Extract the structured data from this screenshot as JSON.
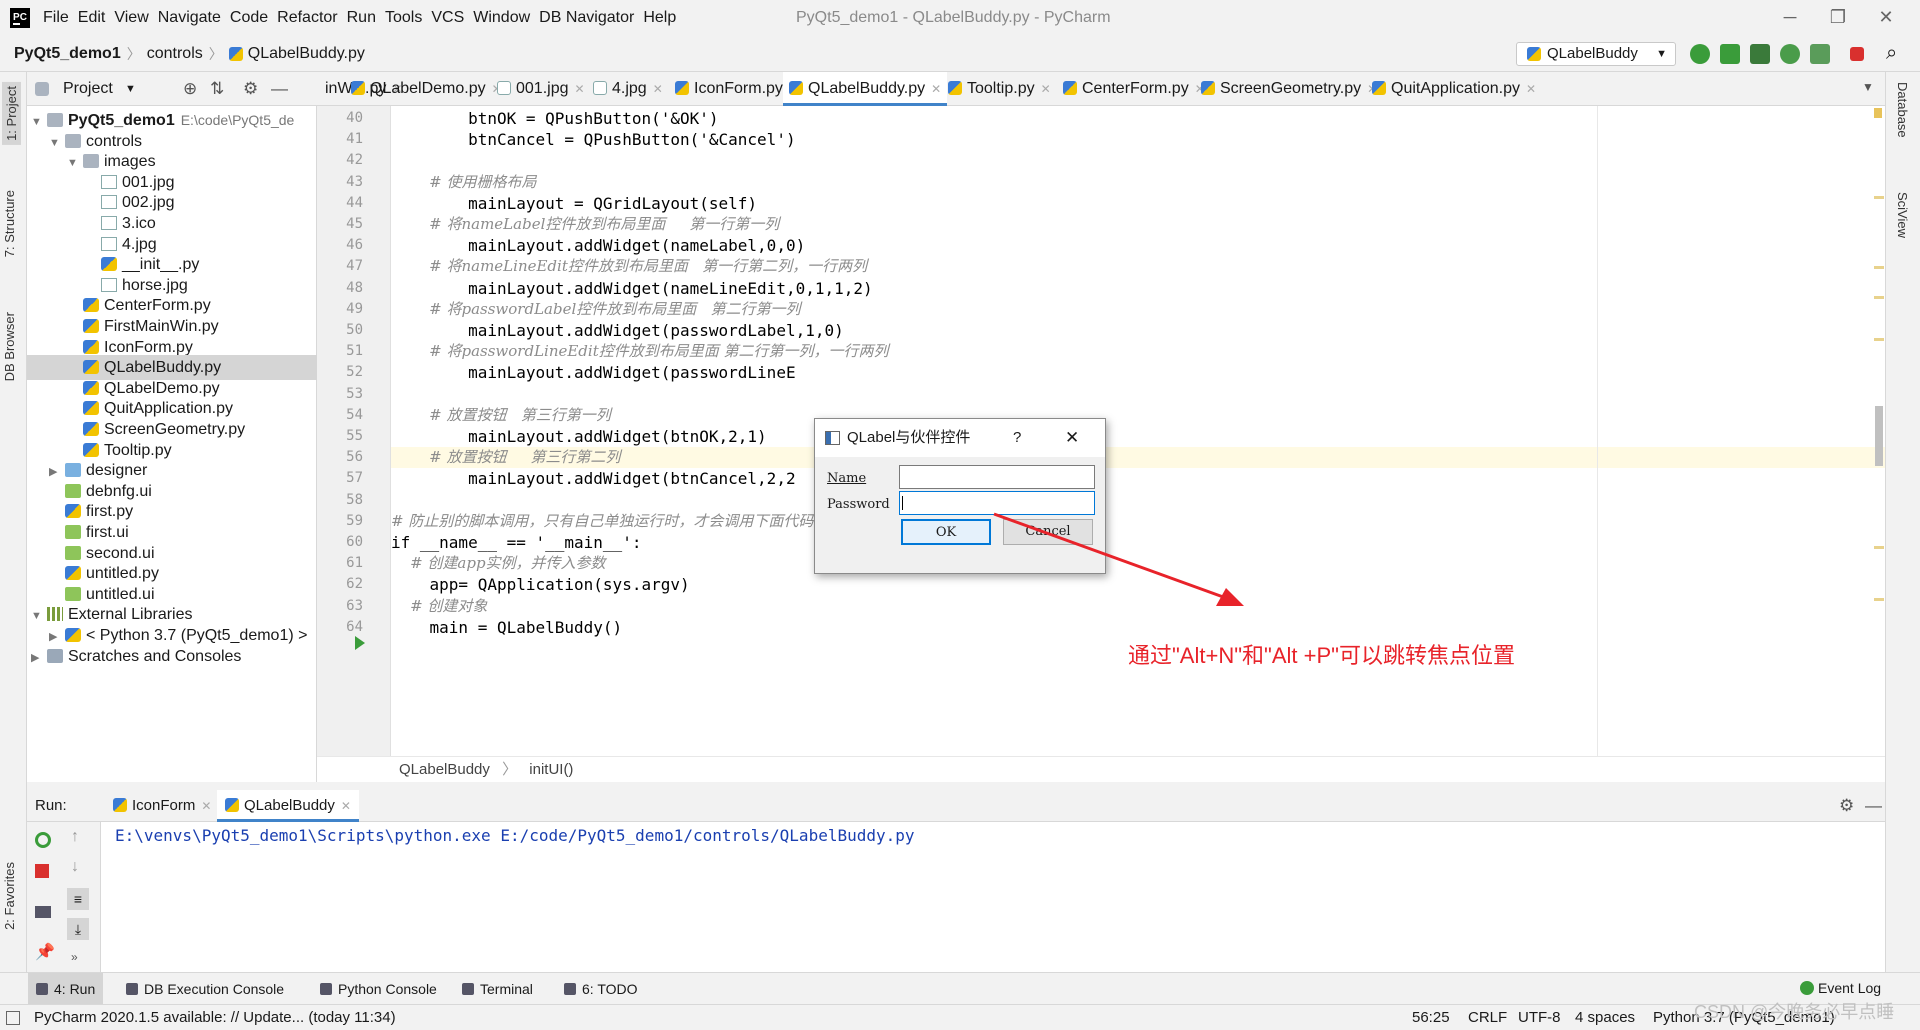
{
  "menu": {
    "items": [
      "File",
      "Edit",
      "View",
      "Navigate",
      "Code",
      "Refactor",
      "Run",
      "Tools",
      "VCS",
      "Window",
      "DB Navigator",
      "Help"
    ],
    "window_title": "PyQt5_demo1 - QLabelBuddy.py - PyCharm"
  },
  "nav": {
    "crumbs": [
      "PyQt5_demo1",
      "controls",
      "QLabelBuddy.py"
    ],
    "run_config": "QLabelBuddy"
  },
  "left_strip": {
    "project": "1: Project",
    "structure": "7: Structure",
    "db_browser": "DB Browser",
    "favorites": "2: Favorites"
  },
  "right_strip": {
    "database": "Database",
    "sciview": "SciView"
  },
  "project_panel": {
    "title": "Project",
    "tree": [
      {
        "label": "PyQt5_demo1",
        "extra": "E:\\code\\PyQt5_de",
        "depth": 0,
        "icon": "folder",
        "arrow": "▼",
        "bold": true
      },
      {
        "label": "controls",
        "depth": 1,
        "icon": "folder",
        "arrow": "▼"
      },
      {
        "label": "images",
        "depth": 2,
        "icon": "folder",
        "arrow": "▼"
      },
      {
        "label": "001.jpg",
        "depth": 3,
        "icon": "img"
      },
      {
        "label": "002.jpg",
        "depth": 3,
        "icon": "img"
      },
      {
        "label": "3.ico",
        "depth": 3,
        "icon": "img"
      },
      {
        "label": "4.jpg",
        "depth": 3,
        "icon": "img"
      },
      {
        "label": "__init__.py",
        "depth": 3,
        "icon": "py"
      },
      {
        "label": "horse.jpg",
        "depth": 3,
        "icon": "img"
      },
      {
        "label": "CenterForm.py",
        "depth": 2,
        "icon": "py"
      },
      {
        "label": "FirstMainWin.py",
        "depth": 2,
        "icon": "py"
      },
      {
        "label": "IconForm.py",
        "depth": 2,
        "icon": "py"
      },
      {
        "label": "QLabelBuddy.py",
        "depth": 2,
        "icon": "py",
        "selected": true
      },
      {
        "label": "QLabelDemo.py",
        "depth": 2,
        "icon": "py"
      },
      {
        "label": "QuitApplication.py",
        "depth": 2,
        "icon": "py"
      },
      {
        "label": "ScreenGeometry.py",
        "depth": 2,
        "icon": "py"
      },
      {
        "label": "Tooltip.py",
        "depth": 2,
        "icon": "py"
      },
      {
        "label": "designer",
        "depth": 1,
        "icon": "folder-blue",
        "arrow": "▶"
      },
      {
        "label": "debnfg.ui",
        "depth": 1,
        "icon": "ui"
      },
      {
        "label": "first.py",
        "depth": 1,
        "icon": "py"
      },
      {
        "label": "first.ui",
        "depth": 1,
        "icon": "ui"
      },
      {
        "label": "second.ui",
        "depth": 1,
        "icon": "ui"
      },
      {
        "label": "untitled.py",
        "depth": 1,
        "icon": "py"
      },
      {
        "label": "untitled.ui",
        "depth": 1,
        "icon": "ui"
      },
      {
        "label": "External Libraries",
        "depth": 0,
        "icon": "lib",
        "arrow": "▼"
      },
      {
        "label": "< Python 3.7 (PyQt5_demo1) >",
        "depth": 1,
        "icon": "py",
        "arrow": "▶"
      },
      {
        "label": "Scratches and Consoles",
        "depth": 0,
        "icon": "scratch",
        "arrow": "▶"
      }
    ]
  },
  "editor_tabs": [
    {
      "label": "inWin.py",
      "icon": "none"
    },
    {
      "label": "QLabelDemo.py",
      "icon": "py"
    },
    {
      "label": "001.jpg",
      "icon": "img"
    },
    {
      "label": "4.jpg",
      "icon": "img"
    },
    {
      "label": "IconForm.py",
      "icon": "py"
    },
    {
      "label": "QLabelBuddy.py",
      "icon": "py",
      "active": true
    },
    {
      "label": "Tooltip.py",
      "icon": "py"
    },
    {
      "label": "CenterForm.py",
      "icon": "py"
    },
    {
      "label": "ScreenGeometry.py",
      "icon": "py"
    },
    {
      "label": "QuitApplication.py",
      "icon": "py"
    }
  ],
  "code": {
    "lines": [
      {
        "n": "40",
        "text": "        btnOK = QPushButton('&OK')"
      },
      {
        "n": "41",
        "text": "        btnCancel = QPushButton('&Cancel')"
      },
      {
        "n": "42",
        "text": ""
      },
      {
        "n": "43",
        "text": "        # 使用栅格布局",
        "comment": true
      },
      {
        "n": "44",
        "text": "        mainLayout = QGridLayout(self)"
      },
      {
        "n": "45",
        "text": "        # 将nameLabel控件放到布局里面     第一行第一列",
        "comment": true
      },
      {
        "n": "46",
        "text": "        mainLayout.addWidget(nameLabel,0,0)"
      },
      {
        "n": "47",
        "text": "        # 将nameLineEdit控件放到布局里面   第一行第二列，一行两列",
        "comment": true
      },
      {
        "n": "48",
        "text": "        mainLayout.addWidget(nameLineEdit,0,1,1,2)"
      },
      {
        "n": "49",
        "text": "        # 将passwordLabel控件放到布局里面   第二行第一列",
        "comment": true
      },
      {
        "n": "50",
        "text": "        mainLayout.addWidget(passwordLabel,1,0)"
      },
      {
        "n": "51",
        "text": "        # 将passwordLineEdit控件放到布局里面 第二行第一列，一行两列",
        "comment": true
      },
      {
        "n": "52",
        "text": "        mainLayout.addWidget(passwordLineE"
      },
      {
        "n": "53",
        "text": ""
      },
      {
        "n": "54",
        "text": "        # 放置按钮   第三行第一列",
        "comment": true
      },
      {
        "n": "55",
        "text": "        mainLayout.addWidget(btnOK,2,1)"
      },
      {
        "n": "56",
        "text": "        # 放置按钮     第三行第二列",
        "comment": true,
        "current": true
      },
      {
        "n": "57",
        "text": "        mainLayout.addWidget(btnCancel,2,2"
      },
      {
        "n": "58",
        "text": ""
      },
      {
        "n": "59",
        "text": "# 防止别的脚本调用，只有自己单独运行时，才会调用下面代码",
        "comment": true
      },
      {
        "n": "60",
        "text": "if __name__ == '__main__':"
      },
      {
        "n": "61",
        "text": "    # 创建app实例，并传入参数",
        "comment": true
      },
      {
        "n": "62",
        "text": "    app= QApplication(sys.argv)"
      },
      {
        "n": "63",
        "text": "    # 创建对象",
        "comment": true
      },
      {
        "n": "64",
        "text": "    main = QLabelBuddy()"
      }
    ]
  },
  "editor_crumbs": [
    "QLabelBuddy",
    "initUI()"
  ],
  "dialog": {
    "title": "QLabel与伙伴控件",
    "help": "?",
    "close": "✕",
    "name_label": "Name",
    "password_label": "Password",
    "name_value": "",
    "password_value": "",
    "ok_label": "OK",
    "cancel_label": "Cancel"
  },
  "annotation": "通过\"Alt+N\"和\"Alt +P\"可以跳转焦点位置",
  "run_panel": {
    "label": "Run:",
    "tabs": [
      {
        "label": "IconForm"
      },
      {
        "label": "QLabelBuddy",
        "active": true
      }
    ],
    "console": "E:\\venvs\\PyQt5_demo1\\Scripts\\python.exe E:/code/PyQt5_demo1/controls/QLabelBuddy.py"
  },
  "bottom_tabs": [
    {
      "label": "4: Run",
      "active": true
    },
    {
      "label": "DB Execution Console"
    },
    {
      "label": "Python Console"
    },
    {
      "label": "Terminal"
    },
    {
      "label": "6: TODO"
    }
  ],
  "event_log": "Event Log",
  "status": {
    "message": "PyCharm 2020.1.5 available: // Update... (today 11:34)",
    "position": "56:25",
    "line_sep": "CRLF",
    "encoding": "UTF-8",
    "indent": "4 spaces",
    "interpreter": "Python 3.7 (PyQt5_demo1)"
  },
  "watermark": "CSDN @今晚务必早点睡",
  "colors": {
    "accent": "#4083c9",
    "annotation": "#e8232a",
    "console": "#1a3fb0"
  }
}
